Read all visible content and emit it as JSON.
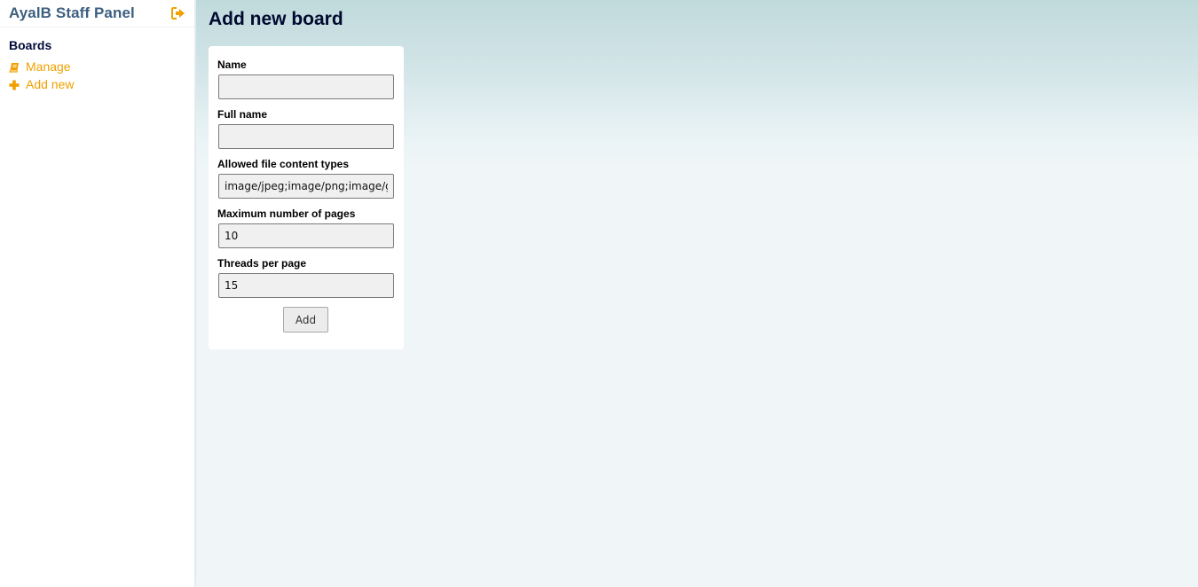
{
  "app": {
    "title": "AyalB Staff Panel"
  },
  "icons": {
    "logout": "sign-out-icon",
    "manage": "book-icon",
    "add_new": "plus-icon"
  },
  "colors": {
    "accent": "#f0a000",
    "title": "#3d5f80",
    "heading": "#000a3a"
  },
  "sidebar": {
    "section_heading": "Boards",
    "items": [
      {
        "label": "Manage",
        "icon": "book-icon"
      },
      {
        "label": "Add new",
        "icon": "plus-icon"
      }
    ]
  },
  "main": {
    "title": "Add new board",
    "form": {
      "fields": [
        {
          "label": "Name",
          "value": ""
        },
        {
          "label": "Full name",
          "value": ""
        },
        {
          "label": "Allowed file content types",
          "value": "image/jpeg;image/png;image/gif"
        },
        {
          "label": "Maximum number of pages",
          "value": "10"
        },
        {
          "label": "Threads per page",
          "value": "15"
        }
      ],
      "submit_label": "Add"
    }
  }
}
